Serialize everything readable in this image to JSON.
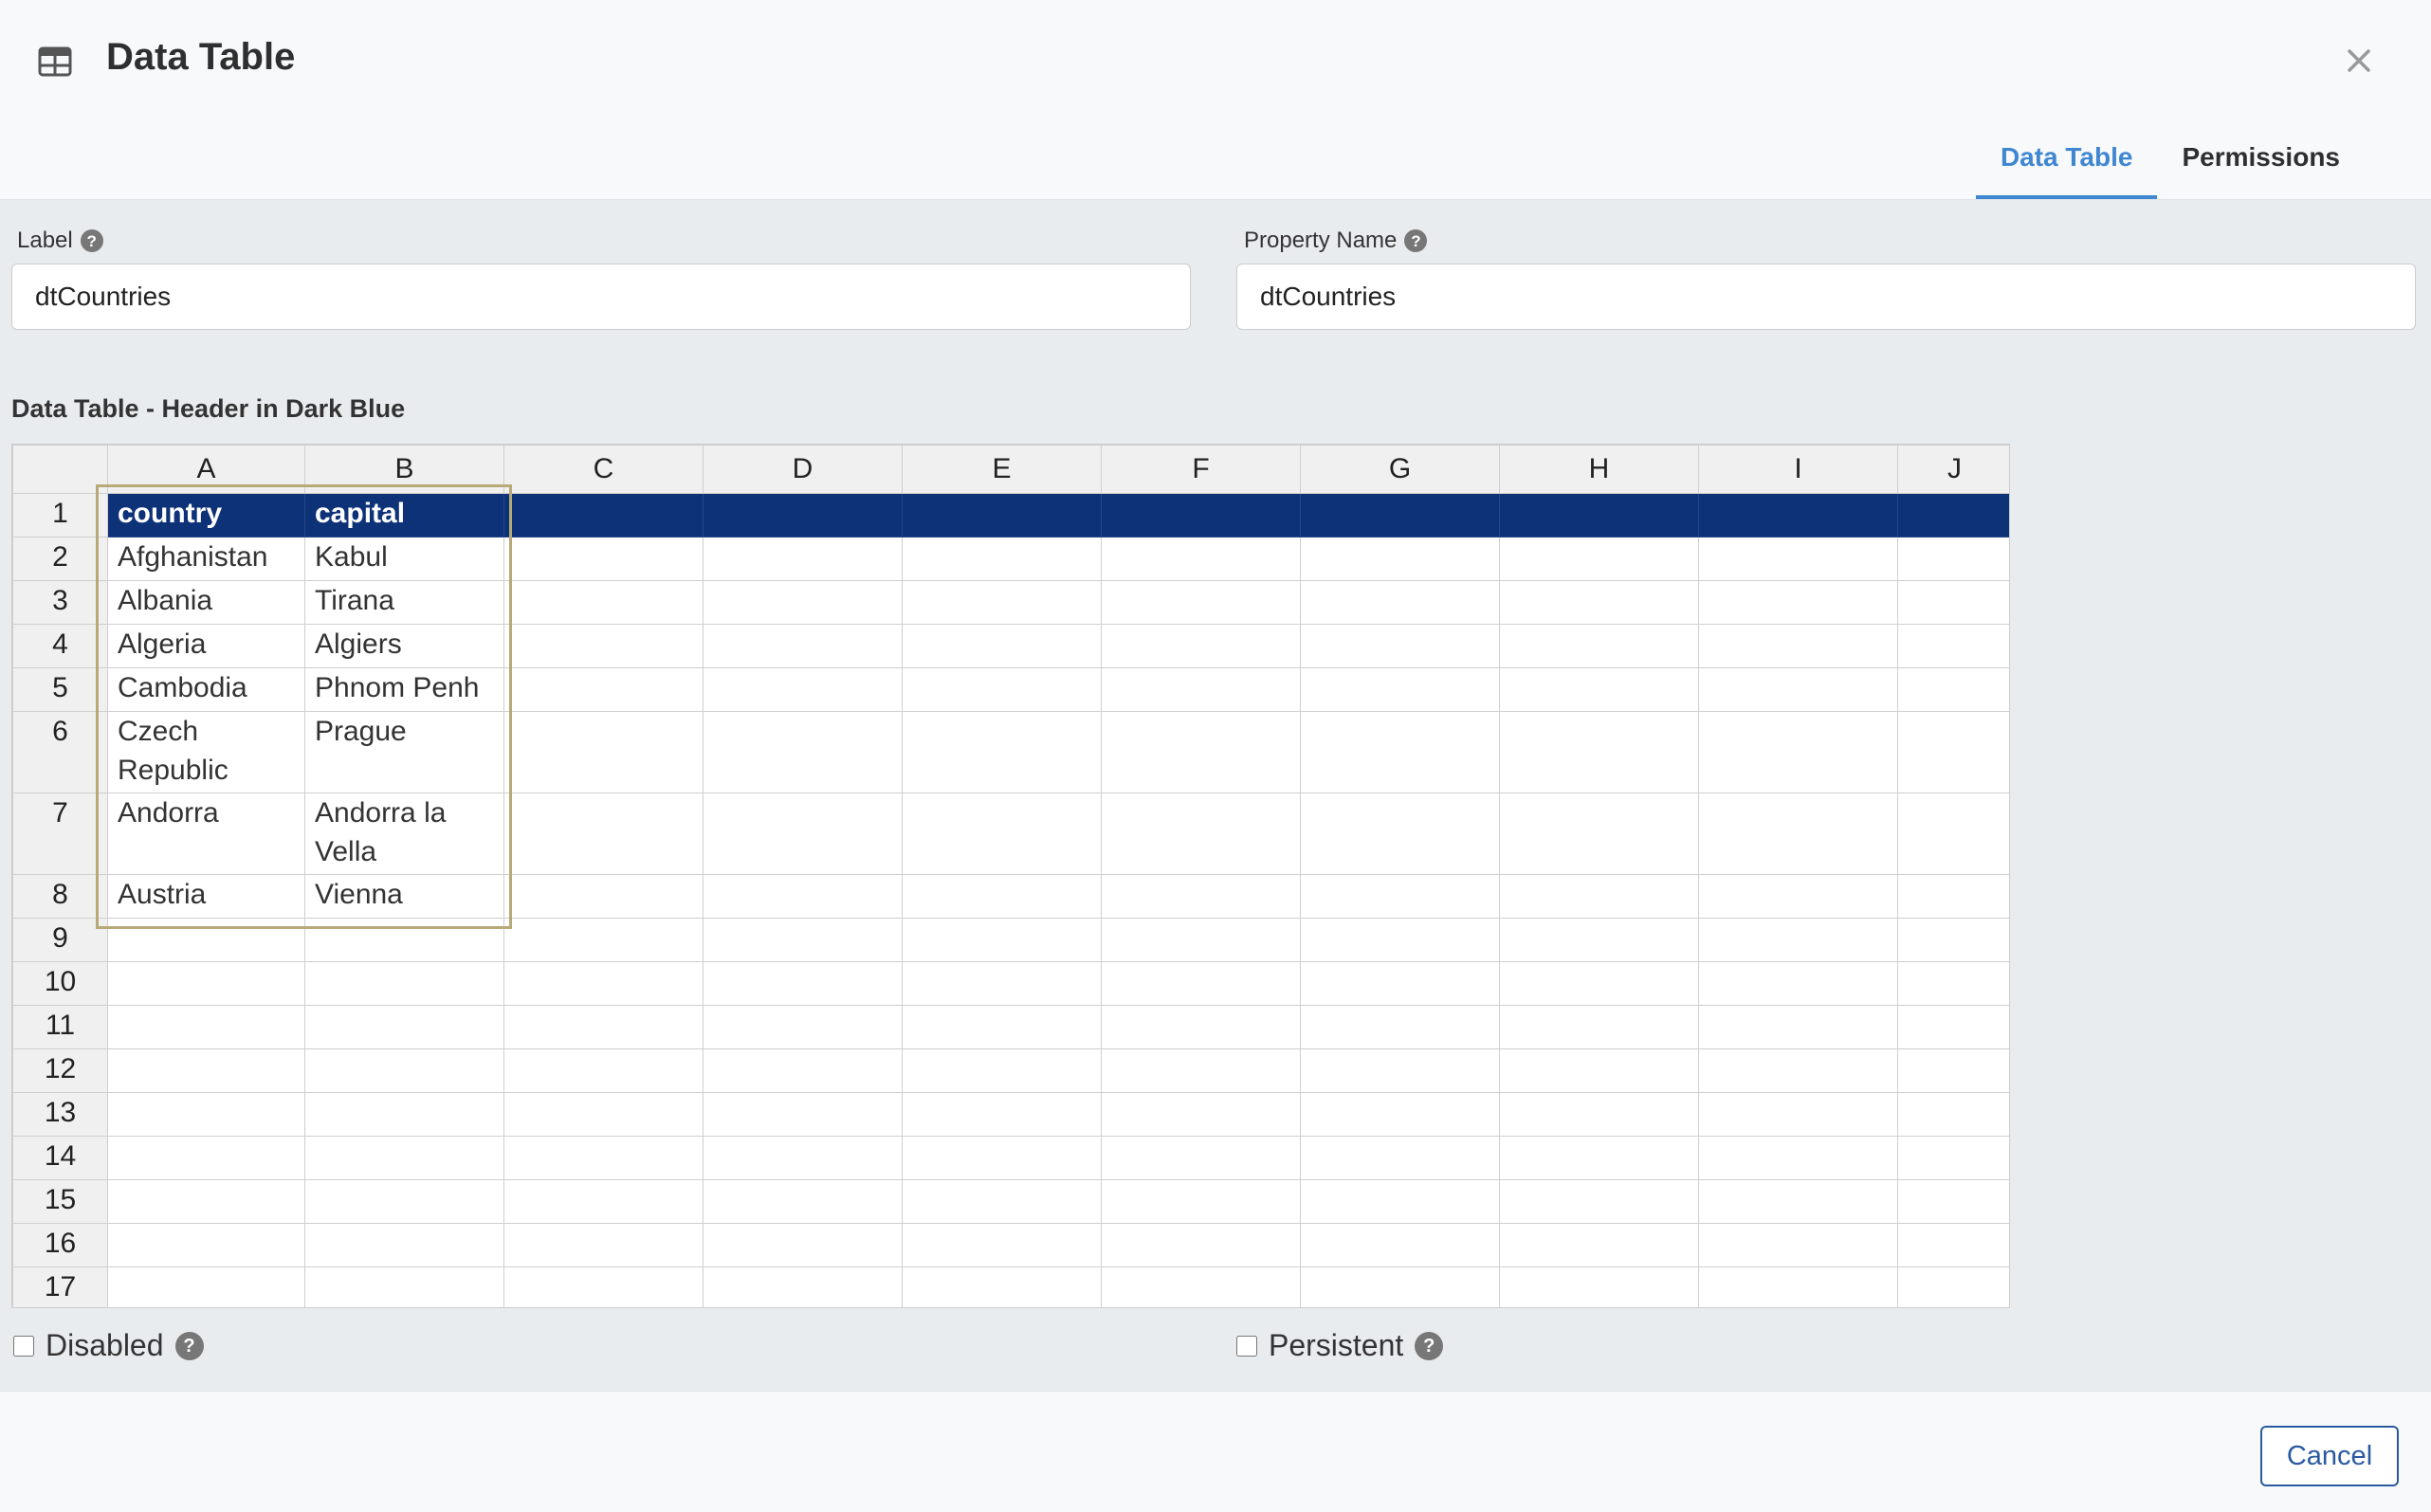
{
  "header": {
    "title": "Data Table",
    "tabs": [
      {
        "label": "Data Table",
        "active": true
      },
      {
        "label": "Permissions",
        "active": false
      }
    ]
  },
  "fields": {
    "label": {
      "label": "Label",
      "value": "dtCountries"
    },
    "property_name": {
      "label": "Property Name",
      "value": "dtCountries"
    }
  },
  "grid": {
    "caption": "Data Table - Header in Dark Blue",
    "header_color": "#0e3278",
    "columns": [
      "A",
      "B",
      "C",
      "D",
      "E",
      "F",
      "G",
      "H",
      "I",
      "J"
    ],
    "rows": [
      [
        "country",
        "capital"
      ],
      [
        "Afghanistan",
        "Kabul"
      ],
      [
        "Albania",
        "Tirana"
      ],
      [
        "Algeria",
        "Algiers"
      ],
      [
        "Cambodia",
        "Phnom Penh"
      ],
      [
        "Czech Republic",
        "Prague"
      ],
      [
        "Andorra",
        "Andorra la Vella"
      ],
      [
        "Austria",
        "Vienna"
      ],
      [],
      [],
      [],
      [],
      [],
      [],
      [],
      [],
      []
    ]
  },
  "options": {
    "disabled": {
      "label": "Disabled",
      "checked": false
    },
    "persistent": {
      "label": "Persistent",
      "checked": false
    }
  },
  "footer": {
    "cancel_label": "Cancel"
  }
}
